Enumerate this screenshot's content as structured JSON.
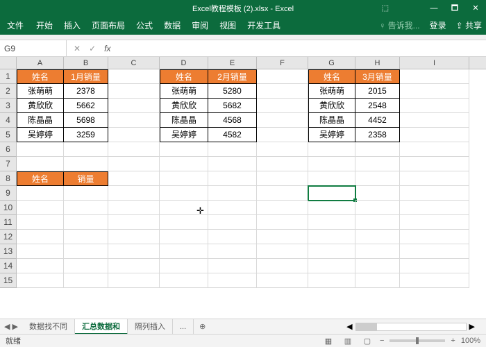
{
  "window": {
    "title": "Excel教程模板 (2).xlsx - Excel",
    "min": "—",
    "max": "🗖",
    "close": "✕",
    "pre": "⬚"
  },
  "ribbon": {
    "file": "文件",
    "tabs": [
      "开始",
      "插入",
      "页面布局",
      "公式",
      "数据",
      "审阅",
      "视图",
      "开发工具"
    ],
    "tellme": "♀ 告诉我...",
    "login": "登录",
    "share": "⇪ 共享"
  },
  "namebox": {
    "ref": "G9",
    "fx": "fx",
    "x": "✕",
    "chk": "✓"
  },
  "colheads": [
    "A",
    "B",
    "C",
    "D",
    "E",
    "F",
    "G",
    "H",
    "I"
  ],
  "colclasses": [
    "cA",
    "cB",
    "cC",
    "cD",
    "cE",
    "cF",
    "cG",
    "cH",
    "cI"
  ],
  "rowheads": [
    "1",
    "2",
    "3",
    "4",
    "5",
    "6",
    "7",
    "8",
    "9",
    "10",
    "11",
    "12",
    "13",
    "14",
    "15"
  ],
  "chart_data": [
    {
      "type": "table",
      "title": "1月",
      "columns": [
        "姓名",
        "1月销量"
      ],
      "rows": [
        [
          "张萌萌",
          2378
        ],
        [
          "黄欣欣",
          5662
        ],
        [
          "陈晶晶",
          5698
        ],
        [
          "吴婷婷",
          3259
        ]
      ]
    },
    {
      "type": "table",
      "title": "2月",
      "columns": [
        "姓名",
        "2月销量"
      ],
      "rows": [
        [
          "张萌萌",
          5280
        ],
        [
          "黄欣欣",
          5682
        ],
        [
          "陈晶晶",
          4568
        ],
        [
          "吴婷婷",
          4582
        ]
      ]
    },
    {
      "type": "table",
      "title": "3月",
      "columns": [
        "姓名",
        "3月销量"
      ],
      "rows": [
        [
          "张萌萌",
          2015
        ],
        [
          "黄欣欣",
          2548
        ],
        [
          "陈晶晶",
          4452
        ],
        [
          "吴婷婷",
          2358
        ]
      ]
    }
  ],
  "summary_header": {
    "name": "姓名",
    "qty": "销量"
  },
  "tabs": {
    "nav": "◀ ▶",
    "items": [
      "数据找不同",
      "汇总数据和",
      "隔列插入",
      "..."
    ],
    "active_index": 1,
    "plus": "⊕"
  },
  "status": {
    "ready": "就绪",
    "glyphs": [
      "▦",
      "▥",
      "▢"
    ],
    "minus": "−",
    "plus": "+",
    "zoom": "100%"
  }
}
